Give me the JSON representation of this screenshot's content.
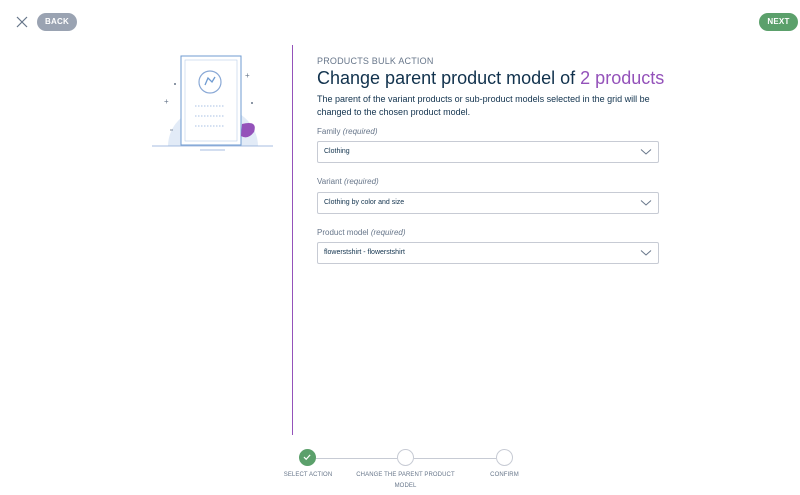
{
  "header": {
    "close_icon": "close-x-icon",
    "back_label": "BACK",
    "next_label": "NEXT",
    "colors": {
      "back_button": "#9aa3b2",
      "next_button": "#5ba06b",
      "accent": "#9452ba"
    }
  },
  "content": {
    "subtitle": "PRODUCTS BULK ACTION",
    "title_prefix": "Change parent product model of ",
    "title_count": "2 products",
    "description": "The parent of the variant products or sub-product models selected in the grid will be changed to the chosen product model."
  },
  "form": {
    "family": {
      "label": "Family",
      "required": "(required)",
      "value": "Clothing"
    },
    "variant": {
      "label": "Variant",
      "required": "(required)",
      "value": "Clothing by color and size"
    },
    "product_model": {
      "label": "Product model",
      "required": "(required)",
      "value": "flowerstshirt - flowerstshirt"
    }
  },
  "steps": [
    {
      "label": "SELECT ACTION",
      "state": "done"
    },
    {
      "label": "CHANGE THE PARENT PRODUCT MODEL",
      "state": "current"
    },
    {
      "label": "CONFIRM",
      "state": "todo"
    }
  ]
}
